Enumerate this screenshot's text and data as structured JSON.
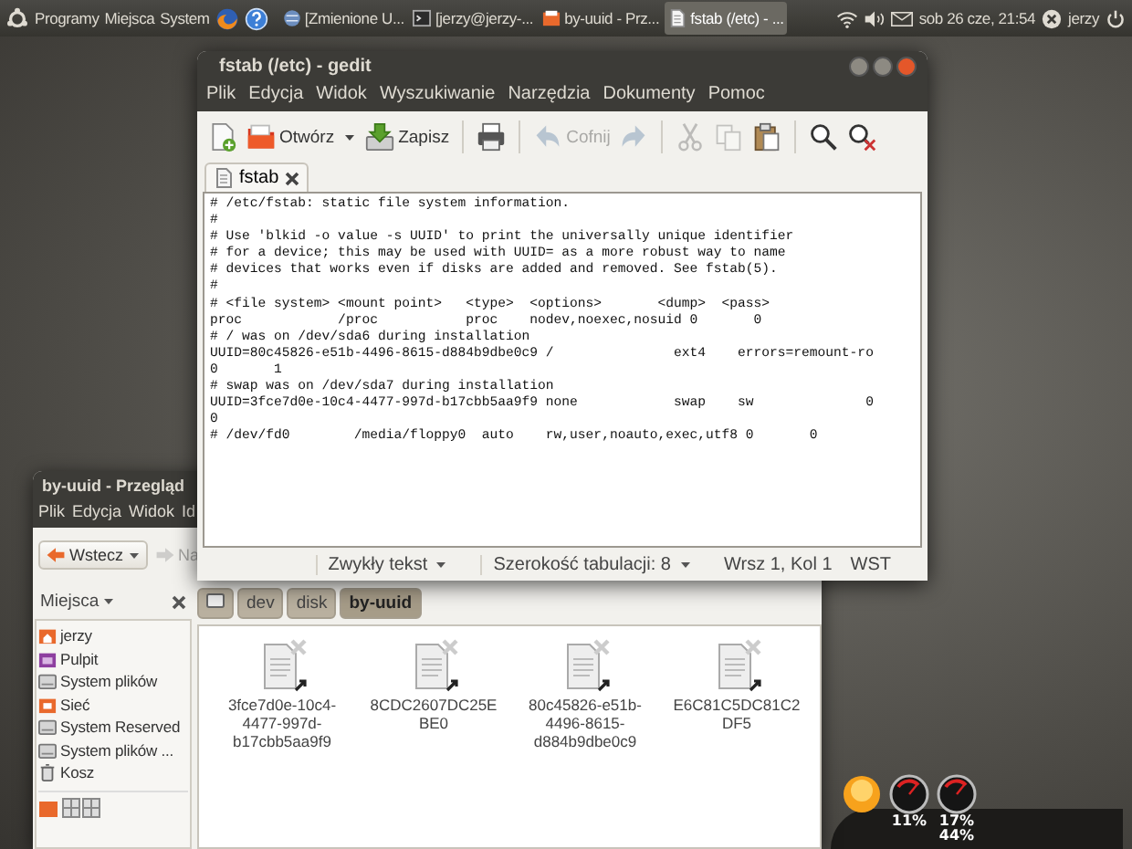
{
  "top_panel": {
    "menus": [
      "Programy",
      "Miejsca",
      "System"
    ],
    "tasks": [
      {
        "label": "[Zmienione U...",
        "kind": "browser",
        "selected": false
      },
      {
        "label": "[jerzy@jerzy-...",
        "kind": "terminal",
        "selected": false
      },
      {
        "label": "by-uuid - Prz...",
        "kind": "folder",
        "selected": false
      },
      {
        "label": "fstab (/etc) - ...",
        "kind": "editor",
        "selected": true
      }
    ],
    "clock": "sob 26 cze, 21:54",
    "user": "jerzy"
  },
  "gedit": {
    "title": "fstab (/etc) - gedit",
    "menu": [
      "Plik",
      "Edycja",
      "Widok",
      "Wyszukiwanie",
      "Narzędzia",
      "Dokumenty",
      "Pomoc"
    ],
    "toolbar": [
      {
        "kind": "new",
        "disabled": false
      },
      {
        "kind": "open",
        "label": "Otwórz",
        "disabled": false
      },
      {
        "kind": "dropdown",
        "disabled": false
      },
      {
        "kind": "save",
        "label": "Zapisz",
        "disabled": false
      },
      {
        "kind": "separator"
      },
      {
        "kind": "print",
        "disabled": false
      },
      {
        "kind": "separator"
      },
      {
        "kind": "undo",
        "label": "Cofnij",
        "disabled": true
      },
      {
        "kind": "redo",
        "disabled": true
      },
      {
        "kind": "separator"
      },
      {
        "kind": "cut",
        "disabled": true
      },
      {
        "kind": "copy",
        "disabled": true
      },
      {
        "kind": "paste",
        "disabled": false
      },
      {
        "kind": "separator"
      },
      {
        "kind": "find",
        "disabled": false
      },
      {
        "kind": "replace",
        "disabled": false
      }
    ],
    "tab": {
      "label": "fstab"
    },
    "lines": [
      "# /etc/fstab: static file system information.",
      "#",
      "# Use 'blkid -o value -s UUID' to print the universally unique identifier",
      "# for a device; this may be used with UUID= as a more robust way to name",
      "# devices that works even if disks are added and removed. See fstab(5).",
      "#",
      "# <file system> <mount point>   <type>  <options>       <dump>  <pass>",
      "proc            /proc           proc    nodev,noexec,nosuid 0       0",
      "# / was on /dev/sda6 during installation",
      "UUID=80c45826-e51b-4496-8615-d884b9dbe0c9 /               ext4    errors=remount-ro",
      "0       1",
      "# swap was on /dev/sda7 during installation",
      "UUID=3fce7d0e-10c4-4477-997d-b17cbb5aa9f9 none            swap    sw              0",
      "0",
      "# /dev/fd0        /media/floppy0  auto    rw,user,noauto,exec,utf8 0       0"
    ],
    "status": {
      "language": "Zwykły tekst",
      "tab_width": "Szerokość tabulacji: 8",
      "position": "Wrsz 1, Kol 1",
      "mode": "WST"
    }
  },
  "file_manager": {
    "title": "by-uuid - Przegląd",
    "menu": [
      "Plik",
      "Edycja",
      "Widok",
      "Id"
    ],
    "back": {
      "label": "Wstecz",
      "disabled": false
    },
    "forward": {
      "label": "Na",
      "disabled": true
    },
    "sidebar": {
      "header": "Miejsca",
      "places": [
        {
          "label": "jerzy",
          "kind": "home"
        },
        {
          "label": "Pulpit",
          "kind": "desktop"
        },
        {
          "label": "System plików",
          "kind": "drive"
        },
        {
          "label": "Sieć",
          "kind": "network"
        },
        {
          "label": "System Reserved",
          "kind": "drive"
        },
        {
          "label": "System plików ...",
          "kind": "drive"
        },
        {
          "label": "Kosz",
          "kind": "trash"
        }
      ]
    },
    "path": [
      {
        "label": "dev",
        "selected": false
      },
      {
        "label": "disk",
        "selected": false
      },
      {
        "label": "by-uuid",
        "selected": true
      }
    ],
    "files": [
      {
        "name": "3fce7d0e-10c4-4477-997d-b17cbb5aa9f9"
      },
      {
        "name": "8CDC2607DC25EBE0"
      },
      {
        "name": "80c45826-e51b-4496-8615-d884b9dbe0c9"
      },
      {
        "name": "E6C81C5DC81C2DF5"
      }
    ]
  },
  "desktop_widgets": {
    "gauges": [
      {
        "readings": [
          "11%"
        ]
      },
      {
        "readings": [
          "17%",
          "44%"
        ]
      }
    ]
  }
}
